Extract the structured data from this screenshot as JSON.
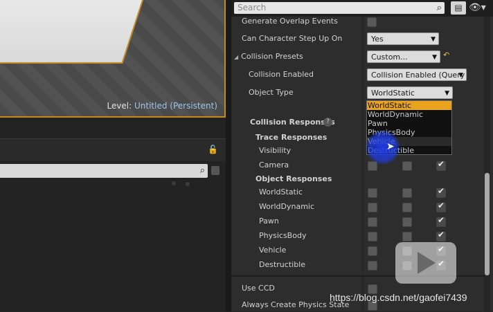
{
  "viewport": {
    "level_label": "Level:",
    "level_name": "Untitled (Persistent)"
  },
  "search": {
    "placeholder": "Search"
  },
  "properties": {
    "generate_overlap": "Generate Overlap Events",
    "can_step_up": "Can Character Step Up On",
    "can_step_up_value": "Yes",
    "collision_presets": "Collision Presets",
    "collision_presets_value": "Custom...",
    "collision_enabled": "Collision Enabled",
    "collision_enabled_value": "Collision Enabled (Query",
    "object_type": "Object Type",
    "object_type_value": "WorldStatic",
    "collision_responses": "Collision Responses",
    "trace_responses": "Trace Responses",
    "visibility": "Visibility",
    "camera": "Camera",
    "object_responses": "Object Responses",
    "worldstatic": "WorldStatic",
    "worlddynamic": "WorldDynamic",
    "pawn": "Pawn",
    "physicsbody": "PhysicsBody",
    "vehicle": "Vehicle",
    "destructible": "Destructible",
    "use_ccd": "Use CCD",
    "always_create": "Always Create Physics State"
  },
  "object_type_options": [
    "WorldStatic",
    "WorldDynamic",
    "Pawn",
    "PhysicsBody",
    "Vehicle",
    "Destructible"
  ],
  "colors": {
    "selection": "#e8a21d",
    "accent": "#c58a1e",
    "cursor": "#1e3ce6"
  },
  "watermark": "https://blog.csdn.net/gaofei7439"
}
